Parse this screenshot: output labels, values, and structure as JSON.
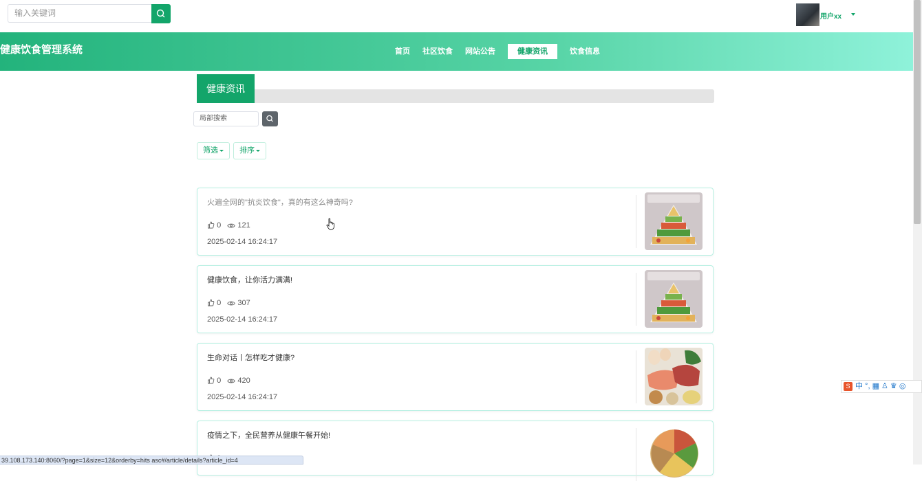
{
  "search": {
    "placeholder": "输入关键词"
  },
  "user": {
    "name": "用户xx"
  },
  "header": {
    "site_title": "健康饮食管理系统"
  },
  "nav": [
    "首页",
    "社区饮食",
    "网站公告",
    "健康资讯",
    "饮食信息"
  ],
  "nav_active": "健康资讯",
  "section": {
    "title": "健康资讯"
  },
  "local_search": {
    "placeholder": "局部搜索"
  },
  "filters": {
    "filter_label": "筛选",
    "sort_label": "排序"
  },
  "articles": [
    {
      "title": "火遍全网的\"抗炎饮食\"，真的有这么神奇吗?",
      "likes": "0",
      "views": "121",
      "date": "2025-02-14 16:24:17",
      "thumb": "food-pyramid"
    },
    {
      "title": "健康饮食，让你活力满满!",
      "likes": "0",
      "views": "307",
      "date": "2025-02-14 16:24:17",
      "thumb": "food-pyramid"
    },
    {
      "title": "生命对话丨怎样吃才健康?",
      "likes": "0",
      "views": "420",
      "date": "2025-02-14 16:24:17",
      "thumb": "protein-foods"
    },
    {
      "title": "疫情之下，全民营养从健康午餐开始!",
      "likes": "0",
      "views": "",
      "date": "",
      "thumb": "food-plate"
    }
  ],
  "status_url": "39.108.173.140:8060/?page=1&size=12&orderby=hits asc#/article/details?article_id=4",
  "ime": {
    "items": "中 °, ▦ ♙ ♛ ◎"
  },
  "colors": {
    "accent": "#13a56a",
    "header_start": "#23b37c",
    "header_end": "#8ff2da"
  }
}
